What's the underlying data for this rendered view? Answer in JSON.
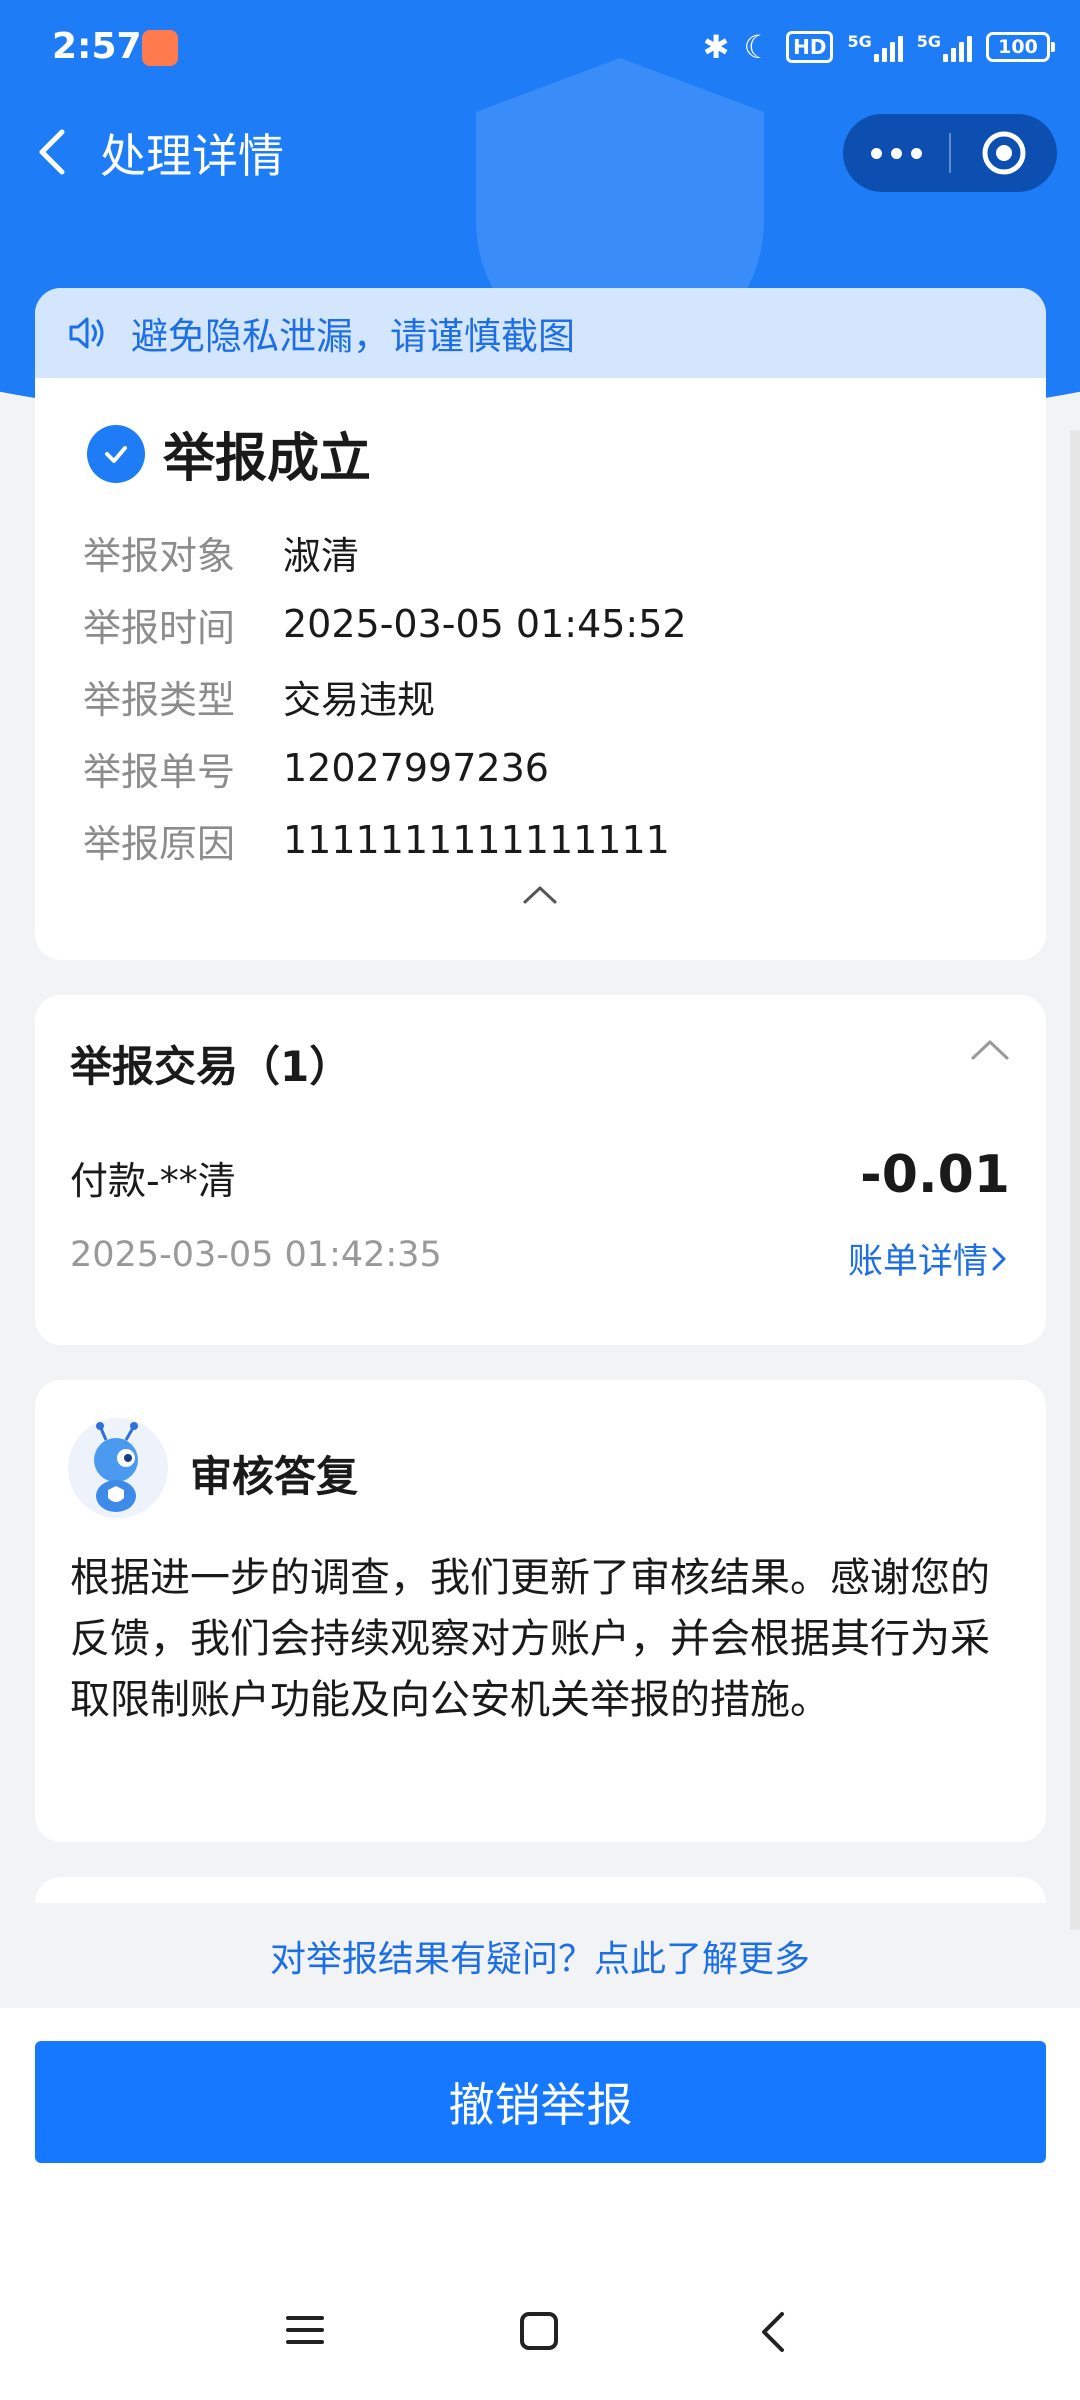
{
  "status_bar": {
    "time": "2:57",
    "hd": "HD",
    "network_1": "5G",
    "network_2": "5G",
    "battery": "100"
  },
  "nav": {
    "title": "处理详情"
  },
  "notice": {
    "text": "避免隐私泄漏，请谨慎截图"
  },
  "report": {
    "status": "举报成立",
    "rows": [
      {
        "label": "举报对象",
        "value": "淑清"
      },
      {
        "label": "举报时间",
        "value": "2025-03-05 01:45:52"
      },
      {
        "label": "举报类型",
        "value": "交易违规"
      },
      {
        "label": "举报单号",
        "value": "12027997236"
      },
      {
        "label": "举报原因",
        "value": "1111111111111111"
      }
    ]
  },
  "transactions": {
    "title": "举报交易（1）",
    "item": {
      "name": "付款-**清",
      "amount": "-0.01",
      "time": "2025-03-05 01:42:35",
      "link": "账单详情"
    }
  },
  "reply": {
    "title": "审核答复",
    "body": "根据进一步的调查，我们更新了审核结果。感谢您的反馈，我们会持续观察对方账户，并会根据其行为采取限制账户功能及向公安机关举报的措施。"
  },
  "help_link": "对举报结果有疑问？点此了解更多",
  "cancel_button": "撤销举报",
  "colors": {
    "primary": "#1e7cf7",
    "link": "#1e6fe6",
    "notice_bg": "#d4e6fd",
    "page_bg": "#f2f3f5"
  },
  "icons": [
    "bluetooth-icon",
    "moon-icon",
    "back-arrow-icon",
    "more-dots-icon",
    "target-icon",
    "speaker-icon",
    "check-circle-icon",
    "chevron-up-icon",
    "chevron-right-icon",
    "ant-mascot-avatar",
    "menu-icon",
    "home-icon",
    "back-icon"
  ]
}
